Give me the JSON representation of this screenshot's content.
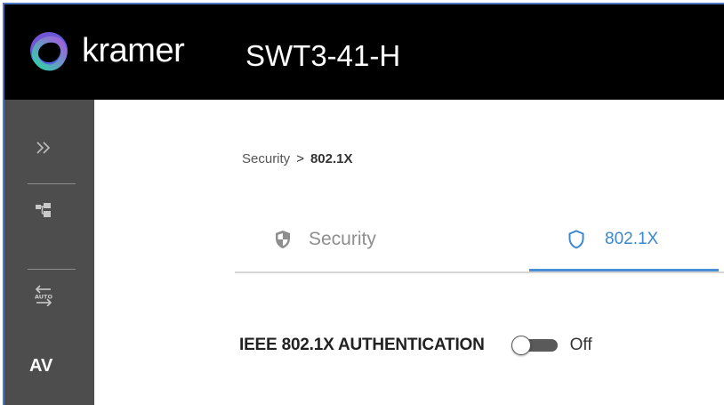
{
  "header": {
    "brand": "kramer",
    "device_title": "SWT3-41-H"
  },
  "sidebar": {
    "items": [
      {
        "name": "expand",
        "icon": "double-chevron-right-icon"
      },
      {
        "name": "hierarchy",
        "icon": "hierarchy-icon"
      },
      {
        "name": "auto-switch",
        "icon": "auto-switch-icon",
        "icon_text": "AUTO"
      },
      {
        "name": "av",
        "label": "AV"
      }
    ]
  },
  "breadcrumb": {
    "parent": "Security",
    "separator": ">",
    "current": "802.1X"
  },
  "tabs": [
    {
      "label": "Security",
      "icon": "shield-half-icon",
      "active": false
    },
    {
      "label": "802.1X",
      "icon": "shield-outline-icon",
      "active": true
    }
  ],
  "auth": {
    "label": "IEEE 802.1X AUTHENTICATION",
    "toggle_state": "Off"
  },
  "colors": {
    "header_bg": "#000000",
    "sidebar_bg": "#4d4d4d",
    "accent": "#3c88d0",
    "inactive_tab": "#8e8e8e",
    "frame_border": "#4a78c4"
  }
}
